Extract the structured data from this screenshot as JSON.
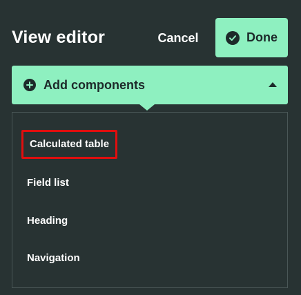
{
  "header": {
    "title": "View editor",
    "cancel_label": "Cancel",
    "done_label": "Done"
  },
  "add_components": {
    "label": "Add components",
    "expanded": true
  },
  "menu": {
    "items": [
      {
        "label": "Calculated table",
        "highlighted": true
      },
      {
        "label": "Field list"
      },
      {
        "label": "Heading"
      },
      {
        "label": "Navigation"
      }
    ]
  },
  "colors": {
    "background": "#283333",
    "accent": "#8ef0c0",
    "dark_text": "#1d2a2a",
    "highlight_border": "#e10e0e"
  }
}
